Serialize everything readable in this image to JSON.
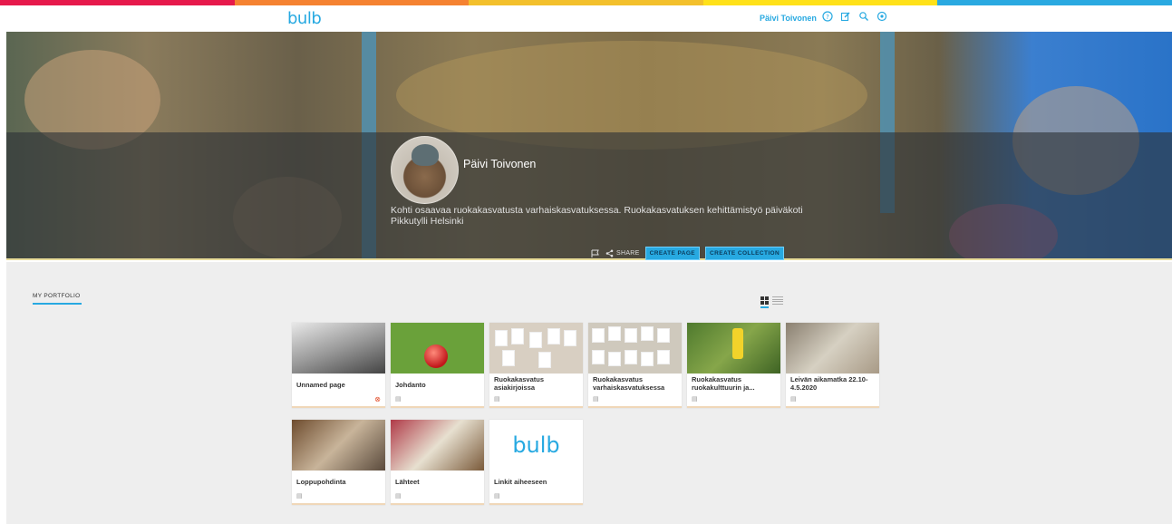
{
  "brand": {
    "logo_text": "bulb",
    "accent": "#27a9e1"
  },
  "rainbow": [
    "#e6194b",
    "#f58231",
    "#f3c02c",
    "#ffe119",
    "#2aa9e1"
  ],
  "topbar": {
    "user_name": "Päivi Toivonen",
    "icons": [
      "help-icon",
      "edit-icon",
      "search-icon",
      "settings-icon"
    ]
  },
  "profile": {
    "name": "Päivi Toivonen",
    "bio": "Kohti osaavaa ruokakasvatusta varhaiskasvatuksessa. Ruokakasvatuksen kehittämistyö päiväkoti Pikkutylli Helsinki"
  },
  "hero_actions": {
    "share_label": "SHARE",
    "create_page_label": "CREATE PAGE",
    "create_collection_label": "CREATE COLLECTION"
  },
  "portfolio": {
    "heading": "MY PORTFOLIO",
    "cards": [
      {
        "title": "Unnamed page"
      },
      {
        "title": "Johdanto"
      },
      {
        "title": "Ruokakasvatus asiakirjoissa"
      },
      {
        "title": "Ruokakasvatus varhaiskasvatuksessa"
      },
      {
        "title": "Ruokakasvatus ruokakulttuurin ja..."
      },
      {
        "title": "Leivän aikamatka 22.10-4.5.2020"
      },
      {
        "title": "Loppupohdinta"
      },
      {
        "title": "Lähteet"
      },
      {
        "title": "Linkit aiheeseen"
      }
    ]
  }
}
